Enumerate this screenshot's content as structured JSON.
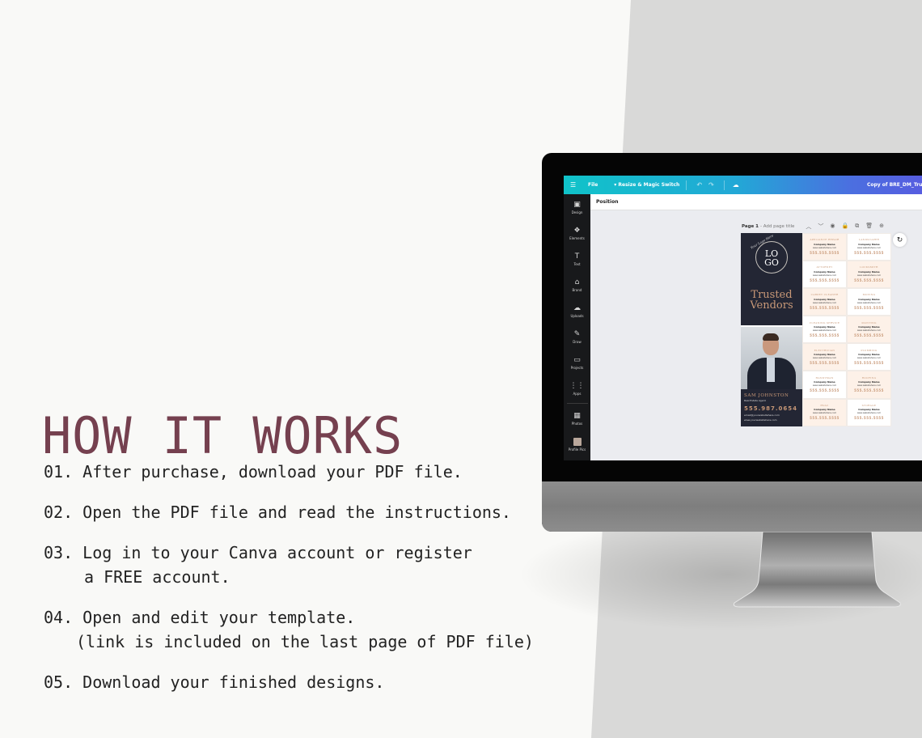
{
  "heading": "HOW IT WORKS",
  "steps": [
    {
      "num": "01.",
      "line1": "After purchase, download your PDF file."
    },
    {
      "num": "02.",
      "line1": "Open the PDF file and read the instructions."
    },
    {
      "num": "03.",
      "line1": "Log in to your Canva account or register",
      "line2": "a FREE account."
    },
    {
      "num": "04.",
      "line1": "Open and edit your template.",
      "line2": "(link is included on the last page of PDF file)"
    },
    {
      "num": "05.",
      "line1": "Download your finished designs."
    }
  ],
  "editor": {
    "topbar": {
      "menu_icon": "☰",
      "file_label": "File",
      "resize_label": "▾ Resize & Magic Switch",
      "undo_icon": "↶",
      "redo_icon": "↷",
      "cloud_icon": "☁",
      "doc_title": "Copy of BRE_DM_Trusted-Ven"
    },
    "sidebar": [
      {
        "icon": "▣",
        "label": "Design"
      },
      {
        "icon": "❖",
        "label": "Elements"
      },
      {
        "icon": "T",
        "label": "Text"
      },
      {
        "icon": "⌂",
        "label": "Brand"
      },
      {
        "icon": "☁",
        "label": "Uploads"
      },
      {
        "icon": "✎",
        "label": "Draw"
      },
      {
        "icon": "▭",
        "label": "Projects"
      },
      {
        "icon": "⋮⋮",
        "label": "Apps"
      },
      {
        "icon": "▦",
        "label": "Photos"
      },
      {
        "icon": "",
        "label": "Profile Pics"
      }
    ],
    "position_label": "Position",
    "page_label": "Page 1",
    "page_title_placeholder": "- Add page title",
    "page_tools": [
      "︿",
      "﹀",
      "◉",
      "🔒",
      "⧉",
      "🗑",
      "⊕"
    ],
    "refresh_icon": "↻",
    "design": {
      "logo_script": "Your Logo Here",
      "logo_text_1": "LO",
      "logo_text_2": "GO",
      "title_1": "Trusted",
      "title_2": "Vendors",
      "agent_name": "SAM JOHNSTON",
      "agent_title": "Real Estate Agent",
      "agent_phone": "555.987.0654",
      "agent_email": "email@yourwebsitehere.com",
      "agent_web": "www.yourwebsitehere.com",
      "vendors": [
        {
          "category": "APPLIANCE REPAIR",
          "company": "Company Name",
          "website": "www.websitehere.com",
          "phone": "555.555.5555"
        },
        {
          "category": "LANDSCAPER",
          "company": "Company Name",
          "website": "www.websitehere.com",
          "phone": "555.555.5555"
        },
        {
          "category": "ATTORNEY",
          "company": "Company Name",
          "website": "www.websitehere.com",
          "phone": "555.555.5555"
        },
        {
          "category": "LOCKSMITH",
          "company": "Company Name",
          "website": "www.websitehere.com",
          "phone": "555.555.5555"
        },
        {
          "category": "CARPET CLEANER",
          "company": "Company Name",
          "website": "www.websitehere.com",
          "phone": "555.555.5555"
        },
        {
          "category": "MOVING",
          "company": "Company Name",
          "website": "www.websitehere.com",
          "phone": "555.555.5555"
        },
        {
          "category": "CLEANING SERVICE",
          "company": "Company Name",
          "website": "www.websitehere.com",
          "phone": "555.555.5555"
        },
        {
          "category": "PAINTING",
          "company": "Company Name",
          "website": "www.websitehere.com",
          "phone": "555.555.5555"
        },
        {
          "category": "ELECTRICIAN",
          "company": "Company Name",
          "website": "www.websitehere.com",
          "phone": "555.555.5555"
        },
        {
          "category": "PLUMBING",
          "company": "Company Name",
          "website": "www.websitehere.com",
          "phone": "555.555.5555"
        },
        {
          "category": "HANDYMAN",
          "company": "Company Name",
          "website": "www.websitehere.com",
          "phone": "555.555.5555"
        },
        {
          "category": "ROOFING",
          "company": "Company Name",
          "website": "www.websitehere.com",
          "phone": "555.555.5555"
        },
        {
          "category": "HVAC",
          "company": "Company Name",
          "website": "www.websitehere.com",
          "phone": "555.555.5555"
        },
        {
          "category": "STORAGE",
          "company": "Company Name",
          "website": "www.websitehere.com",
          "phone": "555.555.5555"
        }
      ]
    }
  },
  "colors": {
    "heading": "#75404f",
    "body_text": "#222222",
    "accent_gold": "#c89877",
    "design_navy": "#232634",
    "cell_peach": "#fdf1e8"
  }
}
